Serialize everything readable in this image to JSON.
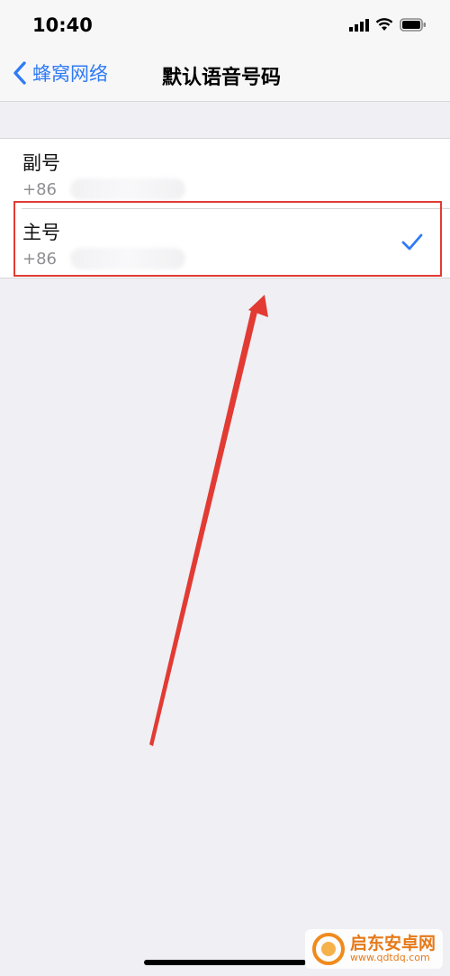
{
  "status_bar": {
    "time": "10:40",
    "icons": [
      "cellular-signal-icon",
      "wifi-icon",
      "battery-icon"
    ]
  },
  "nav": {
    "back_label": "蜂窝网络",
    "title": "默认语音号码"
  },
  "lines": [
    {
      "label": "副号",
      "number_prefix": "+86",
      "selected": false
    },
    {
      "label": "主号",
      "number_prefix": "+86",
      "selected": true
    }
  ],
  "watermark": {
    "brand": "启东安卓网",
    "url": "www.qdtdq.com"
  },
  "colors": {
    "accent": "#2f7bf5",
    "annotation_red": "#e23b33",
    "background": "#efeff4"
  }
}
